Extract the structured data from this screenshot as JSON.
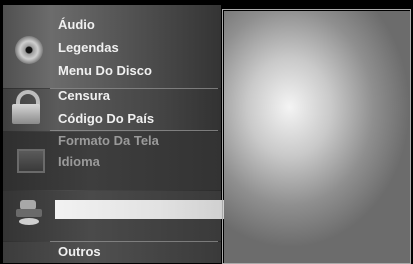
{
  "menu": {
    "items": [
      {
        "label": "Áudio",
        "state": "active"
      },
      {
        "label": "Legendas",
        "state": "active"
      },
      {
        "label": "Menu Do Disco",
        "state": "active"
      },
      {
        "label": "Censura",
        "state": "active"
      },
      {
        "label": "Código Do País",
        "state": "active"
      },
      {
        "label": "Formato Da Tela",
        "state": "dim"
      },
      {
        "label": "Idioma",
        "state": "dim"
      },
      {
        "label": "Outros",
        "state": "active"
      }
    ],
    "icons": [
      "disc-icon",
      "lock-icon",
      "screen-icon",
      "setup-icon"
    ]
  },
  "colors": {
    "active_text": "#f0f0f0",
    "dim_text": "#9a9a9a",
    "highlight": "#e8e8e8"
  }
}
